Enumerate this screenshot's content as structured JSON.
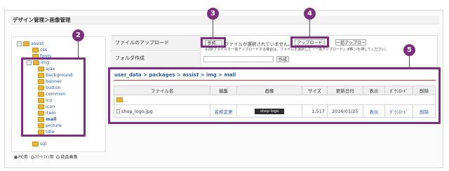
{
  "page_title": "デザイン管理＞画像管理",
  "tree": {
    "root": "assist",
    "items": [
      "css",
      "fonts",
      "img",
      "ajax",
      "background",
      "banner",
      "button",
      "common",
      "ico",
      "icon",
      "item",
      "mall",
      "picture",
      "title",
      "sql"
    ]
  },
  "upload": {
    "label": "ファイルのアップロード",
    "browse_label": "参照...",
    "no_file_text": "ファイルが選択されていません。",
    "upload_button": "アップロード",
    "bulk_upload_button": "一括アップロード",
    "note": "※ZIPファイルで一括アップロードする場合は、ファイルを選択して「一括アップロード」ボタンを押してください。"
  },
  "folder": {
    "label": "フォルダ作成",
    "create_button": "作成"
  },
  "breadcrumb": "user_data > packages > assist > img > mall",
  "file_table": {
    "headers": [
      "ファイル名",
      "編集",
      "画像",
      "サイズ",
      "更新日付",
      "表示",
      "ﾀﾞｳﾝﾛｰﾄﾞ",
      "削除"
    ],
    "parent_row": "..",
    "rows": [
      {
        "name": "shop_logo.jpg",
        "edit": "名称変更",
        "preview_text": "shop logo",
        "size": "1,517",
        "date": "2016/01/25",
        "view": "表示",
        "download": "ﾀﾞｳﾝﾛｰﾄﾞ",
        "delete": "削除"
      }
    ]
  },
  "device_options": [
    "PC用",
    "ｽﾏｰﾄﾌｫﾝ用",
    "商品画像"
  ],
  "callouts": [
    "2",
    "3",
    "4",
    "5"
  ],
  "colors": {
    "highlight": "#7b2f7d",
    "link": "#2a5a9a",
    "rule": "#c0392b"
  }
}
